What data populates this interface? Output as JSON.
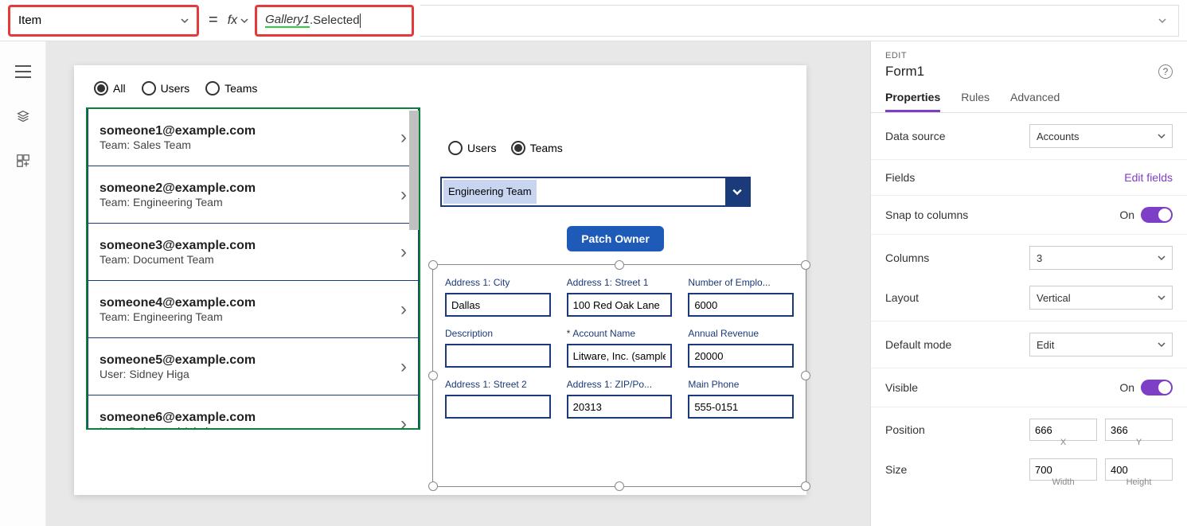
{
  "formula_bar": {
    "property": "Item",
    "fx_label": "fx",
    "ref": "Gallery1",
    "rest": ".Selected"
  },
  "canvas": {
    "filter1": {
      "options": [
        "All",
        "Users",
        "Teams"
      ],
      "selected": 0
    },
    "filter2": {
      "options": [
        "Users",
        "Teams"
      ],
      "selected": 1
    },
    "team_dropdown": "Engineering Team",
    "patch_button": "Patch Owner",
    "gallery": [
      {
        "email": "someone1@example.com",
        "sub": "Team: Sales Team"
      },
      {
        "email": "someone2@example.com",
        "sub": "Team: Engineering Team"
      },
      {
        "email": "someone3@example.com",
        "sub": "Team: Document Team"
      },
      {
        "email": "someone4@example.com",
        "sub": "Team: Engineering Team"
      },
      {
        "email": "someone5@example.com",
        "sub": "User: Sidney Higa"
      },
      {
        "email": "someone6@example.com",
        "sub": "User: Delegated Admin"
      }
    ],
    "form_fields": [
      {
        "label": "Address 1: City",
        "value": "Dallas",
        "required": false
      },
      {
        "label": "Address 1: Street 1",
        "value": "100 Red Oak Lane",
        "required": false
      },
      {
        "label": "Number of Emplo...",
        "value": "6000",
        "required": false
      },
      {
        "label": "Description",
        "value": "",
        "required": false
      },
      {
        "label": "Account Name",
        "value": "Litware, Inc. (sample)",
        "required": true
      },
      {
        "label": "Annual Revenue",
        "value": "20000",
        "required": false
      },
      {
        "label": "Address 1: Street 2",
        "value": "",
        "required": false
      },
      {
        "label": "Address 1: ZIP/Po...",
        "value": "20313",
        "required": false
      },
      {
        "label": "Main Phone",
        "value": "555-0151",
        "required": false
      }
    ]
  },
  "props": {
    "edit_label": "EDIT",
    "title": "Form1",
    "tabs": [
      "Properties",
      "Rules",
      "Advanced"
    ],
    "active_tab": 0,
    "data_source_label": "Data source",
    "data_source_value": "Accounts",
    "fields_label": "Fields",
    "edit_fields": "Edit fields",
    "snap_label": "Snap to columns",
    "snap_value": "On",
    "columns_label": "Columns",
    "columns_value": "3",
    "layout_label": "Layout",
    "layout_value": "Vertical",
    "mode_label": "Default mode",
    "mode_value": "Edit",
    "visible_label": "Visible",
    "visible_value": "On",
    "position_label": "Position",
    "position_x": "666",
    "position_y": "366",
    "size_label": "Size",
    "size_w": "700",
    "size_h": "400",
    "x_label": "X",
    "y_label": "Y",
    "w_label": "Width",
    "h_label": "Height"
  }
}
